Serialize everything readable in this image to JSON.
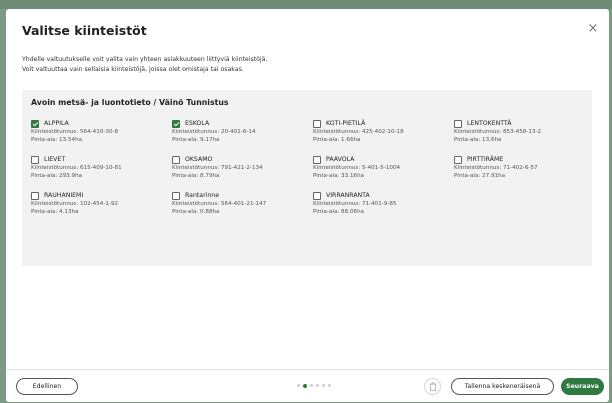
{
  "modal": {
    "title": "Valitse kiinteistöt",
    "close_glyph": "×",
    "description_line1": "Yhdelle valtuutukselle voit valita vain yhteen asiakkuuteen liittyviä kiinteistöjä.",
    "description_line2": "Voit valtuuttaa vain sellaisia kiinteistöjä, joissa olet omistaja tai osakas."
  },
  "group": {
    "title": "Avoin metsä- ja luontotieto / Väinö Tunnistus",
    "properties": [
      {
        "name": "ALPPILA",
        "id_line": "Kiinteistötunnus: 564-410-30-8",
        "area_line": "Pinta-ala: 13.54ha",
        "checked": true
      },
      {
        "name": "ESKOLA",
        "id_line": "Kiinteistötunnus: 20-401-6-14",
        "area_line": "Pinta-ala: 9.17ha",
        "checked": true
      },
      {
        "name": "KOTI-PIETILÄ",
        "id_line": "Kiinteistötunnus: 425-402-10-18",
        "area_line": "Pinta-ala: 1.66ha",
        "checked": false
      },
      {
        "name": "LENTOKENTTÄ",
        "id_line": "Kiinteistötunnus: 853-458-13-2",
        "area_line": "Pinta-ala: 13.6ha",
        "checked": false
      },
      {
        "name": "LIEVET",
        "id_line": "Kiinteistötunnus: 615-409-10-81",
        "area_line": "Pinta-ala: 293.9ha",
        "checked": false
      },
      {
        "name": "OKSAMO",
        "id_line": "Kiinteistötunnus: 791-421-2-134",
        "area_line": "Pinta-ala: 8.79ha",
        "checked": false
      },
      {
        "name": "PAAVOLA",
        "id_line": "Kiinteistötunnus: 5-401-5-1004",
        "area_line": "Pinta-ala: 33.16ha",
        "checked": false
      },
      {
        "name": "PIRTTIRÄME",
        "id_line": "Kiinteistötunnus: 71-402-6-57",
        "area_line": "Pinta-ala: 27.91ha",
        "checked": false
      },
      {
        "name": "RAUHANIEMI",
        "id_line": "Kiinteistötunnus: 102-454-1-92",
        "area_line": "Pinta-ala: 4.13ha",
        "checked": false
      },
      {
        "name": "Rantarinne",
        "id_line": "Kiinteistötunnus: 564-401-21-147",
        "area_line": "Pinta-ala: 0.88ha",
        "checked": false
      },
      {
        "name": "VIRRANRANTA",
        "id_line": "Kiinteistötunnus: 71-401-9-85",
        "area_line": "Pinta-ala: 88.06ha",
        "checked": false
      }
    ]
  },
  "footer": {
    "prev_label": "Edellinen",
    "save_draft_label": "Tallenna keskeneräisenä",
    "next_label": "Seuraava",
    "steps_total": 6,
    "current_step": 2
  },
  "colors": {
    "accent": "#2e7a40",
    "panel": "#f2f2f2",
    "backdrop": "#7e9a84"
  },
  "icons": {
    "close": "close-icon",
    "trash": "trash-icon",
    "check": "checkbox-checked-icon"
  }
}
